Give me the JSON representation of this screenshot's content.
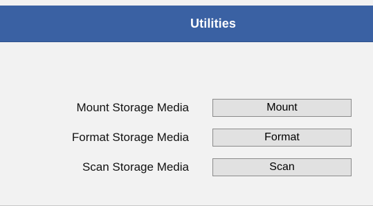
{
  "header": {
    "title": "Utilities"
  },
  "colors": {
    "header_bg": "#3a61a3",
    "page_bg": "#f2f2f2",
    "button_bg": "#e1e1e1"
  },
  "rows": [
    {
      "label": "Mount Storage Media",
      "button": "Mount"
    },
    {
      "label": "Format Storage Media",
      "button": "Format"
    },
    {
      "label": "Scan Storage Media",
      "button": "Scan"
    }
  ]
}
